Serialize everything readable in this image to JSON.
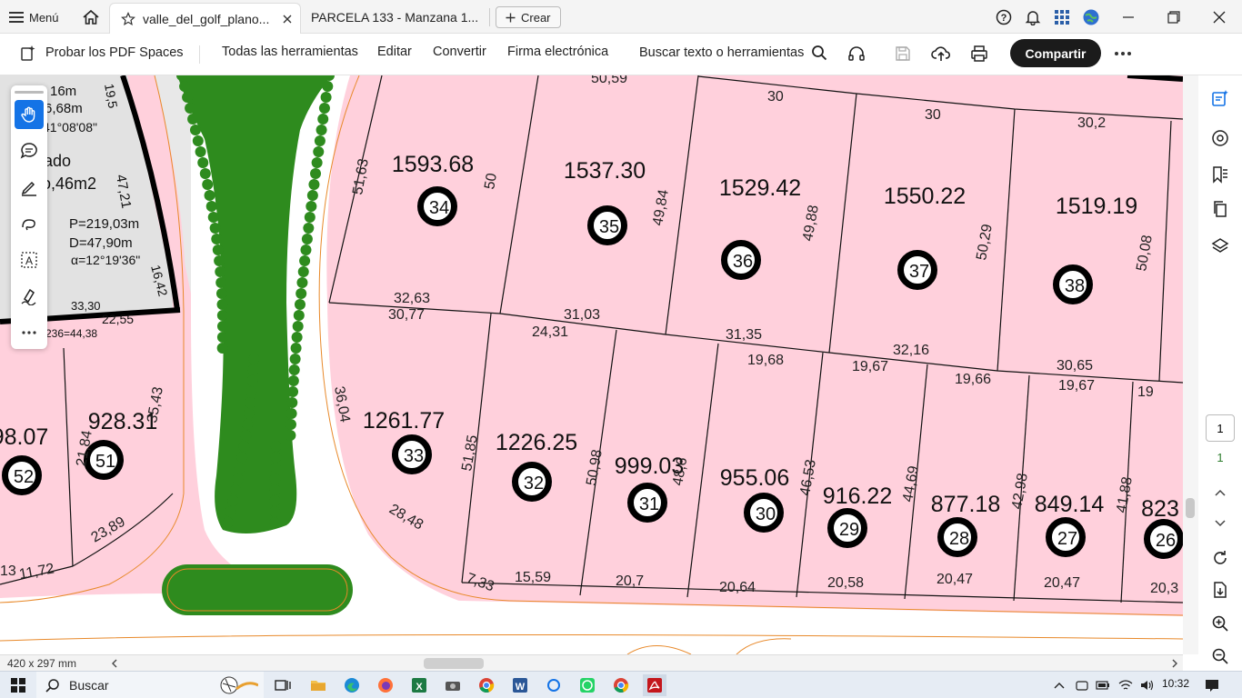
{
  "tabbar": {
    "menu_label": "Menú",
    "tabs": [
      {
        "label": "valle_del_golf_plano...",
        "active": true
      },
      {
        "label": "PARCELA 133 - Manzana 1...",
        "active": false
      }
    ],
    "create_label": "Crear"
  },
  "toolbar": {
    "pdf_spaces": "Probar los PDF Spaces",
    "all_tools": "Todas las herramientas",
    "edit": "Editar",
    "convert": "Convertir",
    "esign": "Firma electrónica",
    "search_tools": "Buscar texto o herramientas",
    "share": "Compartir"
  },
  "plan": {
    "corner_text": [
      "16m",
      "6,68m",
      "41°08'08\"",
      "ado",
      "o,46m2",
      "P=219,03m",
      "D=47,90m",
      "α=12°19'36\""
    ],
    "misc_labels": [
      "33,30",
      "22,55",
      "236=44,38",
      "47,21",
      "16,42",
      "19,5"
    ],
    "lots_upper": [
      {
        "num": "34",
        "area": "1593.68"
      },
      {
        "num": "35",
        "area": "1537.30"
      },
      {
        "num": "36",
        "area": "1529.42"
      },
      {
        "num": "37",
        "area": "1550.22"
      },
      {
        "num": "38",
        "area": "1519.19"
      }
    ],
    "lots_lower": [
      {
        "num": "52",
        "area": "98.07"
      },
      {
        "num": "51",
        "area": "928.31"
      },
      {
        "num": "33",
        "area": "1261.77"
      },
      {
        "num": "32",
        "area": "1226.25"
      },
      {
        "num": "31",
        "area": "999.03"
      },
      {
        "num": "30",
        "area": "955.06"
      },
      {
        "num": "29",
        "area": "916.22"
      },
      {
        "num": "28",
        "area": "877.18"
      },
      {
        "num": "27",
        "area": "849.14"
      },
      {
        "num": "26",
        "area": "823"
      }
    ],
    "dimensions_upper": [
      "30",
      "30",
      "30,2",
      "51,63",
      "50",
      "49,84",
      "49,88",
      "50,29",
      "50,08",
      "32,63",
      "30,77",
      "31,03",
      "24,31",
      "31,35",
      "32,16",
      "30,65"
    ],
    "dimensions_lower": [
      "36,04",
      "28,48",
      "51,85",
      "50,98",
      "48,6",
      "19,68",
      "19,67",
      "19,66",
      "19,67",
      "46,53",
      "44,69",
      "42,98",
      "41,88",
      "7,33",
      "15,59",
      "20,7",
      "20,64",
      "20,58",
      "20,47",
      "20,47",
      "20,3",
      "11,72",
      "23,89",
      "35,43",
      "21,84",
      "19",
      "13",
      "50,59"
    ]
  },
  "status": {
    "page_size": "420 x 297 mm",
    "page_current": "1",
    "page_total": "1"
  },
  "taskbar": {
    "search_label": "Buscar",
    "time": "10:32"
  },
  "colors": {
    "lot_fill": "#ffd0dc",
    "green_area": "#2e8b1e",
    "road_line": "#e8892a",
    "share_bg": "#1b1b1b",
    "accent": "#1473e6"
  }
}
